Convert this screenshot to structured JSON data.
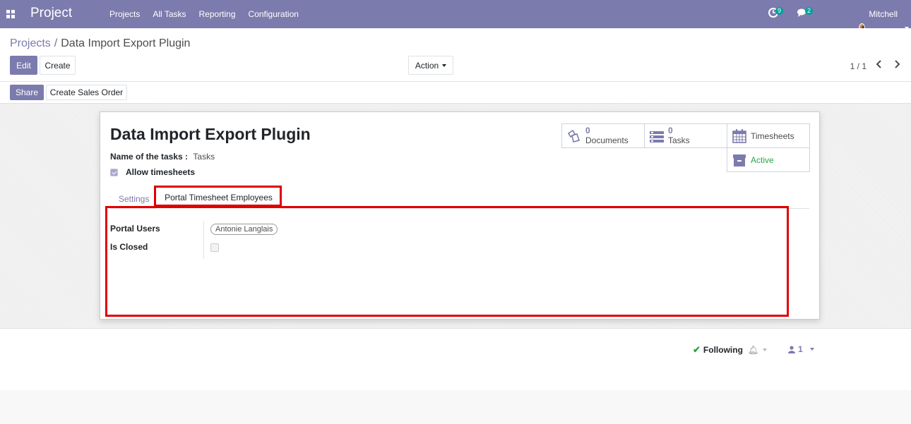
{
  "navbar": {
    "brand": "Project",
    "menu": [
      "Projects",
      "All Tasks",
      "Reporting",
      "Configuration"
    ],
    "activity_count": "9",
    "message_count": "2",
    "user_name": "Mitchell Admin"
  },
  "breadcrumb": {
    "parent": "Projects",
    "separator": "/",
    "current": "Data Import Export Plugin"
  },
  "buttons": {
    "edit": "Edit",
    "create": "Create",
    "action": "Action",
    "share": "Share",
    "create_sales_order": "Create Sales Order"
  },
  "pager": {
    "value": "1 / 1"
  },
  "record": {
    "title": "Data Import Export Plugin",
    "task_name_label": "Name of the tasks :",
    "task_name_value": "Tasks",
    "allow_timesheets_label": "Allow timesheets",
    "allow_timesheets_checked": true
  },
  "smart_buttons": {
    "documents": {
      "count": "0",
      "label": "Documents"
    },
    "tasks": {
      "count": "0",
      "label": "Tasks"
    },
    "timesheets": {
      "label": "Timesheets"
    },
    "active": {
      "label": "Active"
    }
  },
  "tabs": [
    "Settings",
    "Portal Timesheet Employees"
  ],
  "portal_tab": {
    "portal_users_label": "Portal Users",
    "portal_users": [
      "Antonie Langlais"
    ],
    "is_closed_label": "Is Closed",
    "is_closed": false
  },
  "chatter": {
    "following_label": "Following",
    "followers_count": "1"
  },
  "colors": {
    "brand": "#7c7bad",
    "highlight": "#e00000",
    "active_green": "#28a745"
  }
}
